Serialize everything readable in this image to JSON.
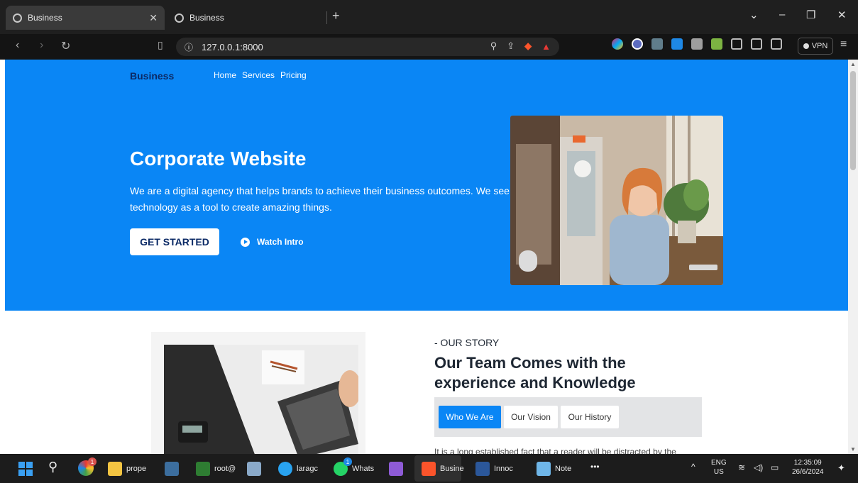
{
  "browser": {
    "tabs": [
      {
        "title": "Business",
        "active": true
      },
      {
        "title": "Business",
        "active": false
      }
    ],
    "new_tab": "+",
    "url": "127.0.0.1:8000",
    "vpn_label": "VPN",
    "window_controls": {
      "dropdown": "⌄",
      "minimize": "–",
      "restore": "❐",
      "close": "✕"
    }
  },
  "site": {
    "brand": "Business",
    "nav": [
      "Home",
      "Services",
      "Pricing"
    ],
    "hero": {
      "title": "Corporate Website",
      "description": "We are a digital agency that helps brands to achieve their business outcomes. We see technology as a tool to create amazing things.",
      "cta_label": "GET STARTED",
      "watch_label": "Watch Intro"
    },
    "story": {
      "label": "- OUR STORY",
      "title": "Our Team Comes with the experience and Knowledge",
      "tabs": [
        "Who We Are",
        "Our Vision",
        "Our History"
      ],
      "text": "It is a long established fact that a reader will be distracted by the"
    }
  },
  "taskbar": {
    "apps": [
      {
        "name": "file-explorer",
        "label": "prope"
      },
      {
        "name": "terminal",
        "label": "root@"
      },
      {
        "name": "laragon",
        "label": "laragc"
      },
      {
        "name": "whatsapp",
        "label": "Whats",
        "badge": "1"
      },
      {
        "name": "brave",
        "label": "Busine"
      },
      {
        "name": "word",
        "label": "Innoc"
      },
      {
        "name": "notepad",
        "label": "Note"
      }
    ],
    "chrome_badge": "1",
    "more": "•••",
    "lang": "ENG",
    "region": "US",
    "time": "12:35:09",
    "date": "26/6/2024"
  },
  "colors": {
    "hero_bg": "#0a86f5",
    "brand": "#0b2a66",
    "tab_active": "#0a86f5"
  }
}
